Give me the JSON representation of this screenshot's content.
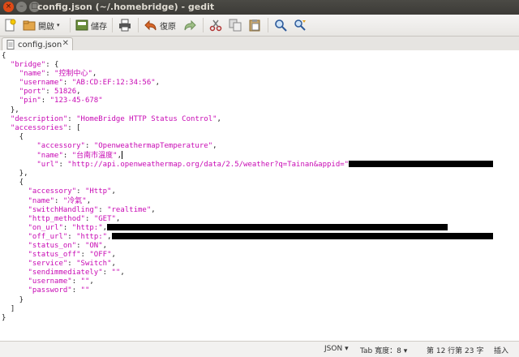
{
  "window": {
    "title": "config.json (~/.homebridge) - gedit"
  },
  "toolbar": {
    "open_label": "開啟",
    "save_label": "儲存",
    "undo_label": "復原"
  },
  "tabs": [
    {
      "label": "config.json"
    }
  ],
  "editor": {
    "lines": [
      "{",
      "  \"bridge\": {",
      "    \"name\": \"控制中心\",",
      "    \"username\": \"AB:CD:EF:12:34:56\",",
      "    \"port\": 51826,",
      "    \"pin\": \"123-45-678\"",
      "  },",
      "  \"description\": \"HomeBridge HTTP Status Control\",",
      "  \"accessories\": [",
      "    {",
      "        \"accessory\": \"OpenweathermapTemperature\",",
      "        \"name\": \"台南市溫度\",",
      "        \"url\": \"http://api.openweathermap.org/data/2.5/weather?q=Tainan&appid=\"",
      "    },",
      "    {",
      "      \"accessory\": \"Http\",",
      "      \"name\": \"冷氣\",",
      "      \"switchHandling\": \"realtime\",",
      "      \"http_method\": \"GET\",",
      "      \"on_url\": \"http:\",",
      "      \"off_url\": \"http:\",",
      "      \"status_on\": \"ON\",",
      "      \"status_off\": \"OFF\",",
      "      \"service\": \"Switch\",",
      "      \"sendimmediately\": \"\",",
      "      \"username\": \"\",",
      "      \"password\": \"\"",
      "    }",
      "  ]",
      "}"
    ]
  },
  "statusbar": {
    "language": "JSON",
    "tab_width": "Tab 寬度：8",
    "position": "第 12 行第 23 字",
    "mode": "插入"
  },
  "colors": {
    "string": "#c80ab4",
    "title_bg": "#3c3b37"
  }
}
